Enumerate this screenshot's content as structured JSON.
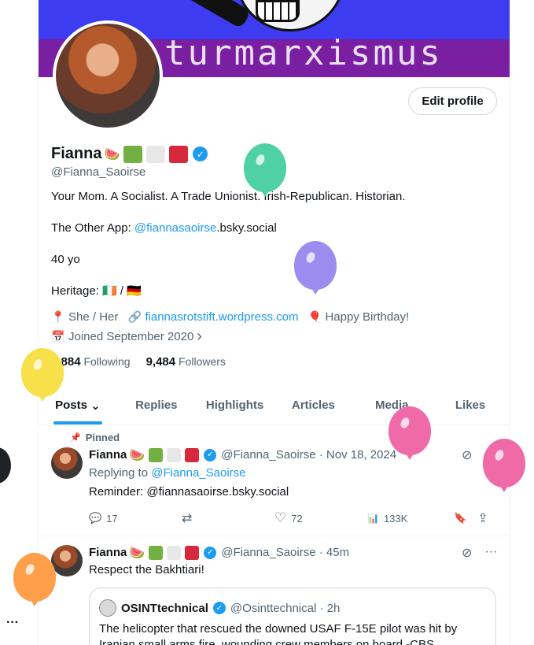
{
  "banner": {
    "text": "turmarxismus"
  },
  "profile": {
    "edit_button": "Edit profile",
    "name": "Fianna",
    "name_emoji": "🍉",
    "flag_colors": [
      "#72b043",
      "#e8e8e8",
      "#d62a3c"
    ],
    "verified_mark": "✓",
    "handle": "@Fianna_Saoirse",
    "bio_line1": "Your Mom. A Socialist. A Trade Unionist. Irish-Republican. Historian.",
    "bio_other_prefix": "The Other App: ",
    "bio_other_link": "@fiannasaoirse",
    "bio_other_suffix": ".bsky.social",
    "bio_age": "40 yo",
    "bio_heritage": "Heritage: 🇮🇪 / 🇩🇪",
    "pronouns": "She / Her",
    "website": "fiannasrotstift.wordpress.com",
    "birthday": "Happy Birthday!",
    "joined": "Joined September 2020",
    "following_count": "4,884",
    "following_label": "Following",
    "followers_count": "9,484",
    "followers_label": "Followers"
  },
  "icons": {
    "location": "📍",
    "link": "🔗",
    "balloon": "🎈",
    "calendar": "📅",
    "chevron_right": "›",
    "chevron_down": "⌄",
    "pin": "📌",
    "reply": "💬",
    "retweet": "⇄",
    "like": "♡",
    "views": "📊",
    "bookmark": "🔖",
    "share": "⇪",
    "grok": "⊘",
    "more": "···"
  },
  "tabs": [
    "Posts",
    "Replies",
    "Highlights",
    "Articles",
    "Media",
    "Likes"
  ],
  "accent_color": "#1d9bf0",
  "post1": {
    "pinned_label": "Pinned",
    "name": "Fianna",
    "name_emoji": "🍉",
    "handle_time": "@Fianna_Saoirse · Nov 18, 2024",
    "replying_prefix": "Replying to ",
    "replying_to": "@Fianna_Saoirse",
    "text": "Reminder: @fiannasaoirse.bsky.social",
    "replies": "17",
    "likes": "72",
    "views": "133K"
  },
  "post2": {
    "name": "Fianna",
    "name_emoji": "🍉",
    "handle_time": "@Fianna_Saoirse · 45m",
    "text": "Respect the Bakhtiari!",
    "quote": {
      "name": "OSINTtechnical",
      "handle_time": "@Osinttechnical · 2h",
      "text": "The helicopter that rescued the downed USAF F-15E pilot was hit by Iranian small arms fire, wounding crew members on board -CBS"
    }
  },
  "balloon_colors": [
    "#4fd1a5",
    "#9d8cf0",
    "#f8e04a",
    "#f06aa8",
    "#f06aa8",
    "#ff9f4a"
  ],
  "left_more": "···"
}
